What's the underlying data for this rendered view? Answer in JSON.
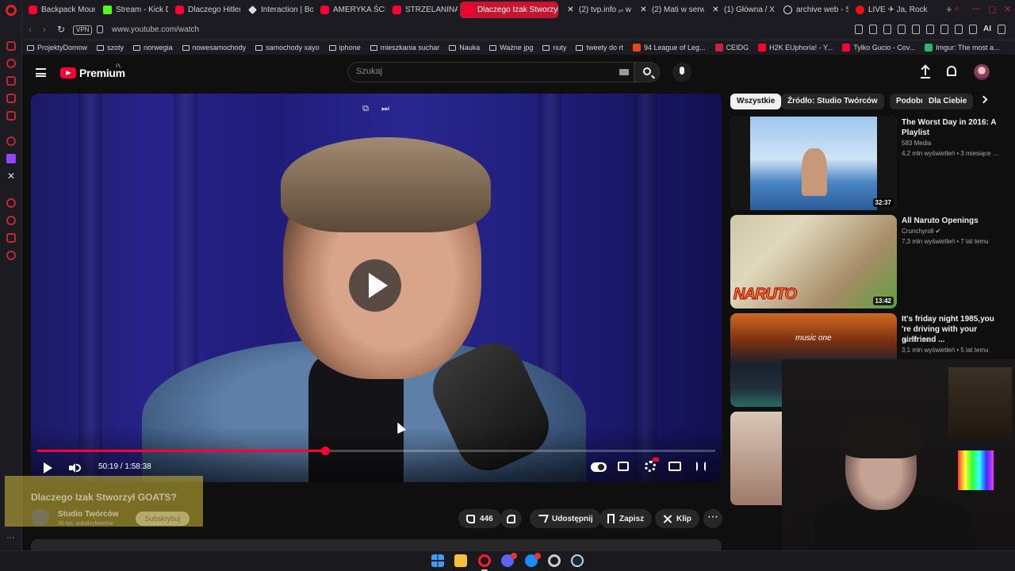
{
  "browser": {
    "tabs": [
      {
        "label": "Backpack Moun",
        "icon": "youtube-icon"
      },
      {
        "label": "Stream - Kick D",
        "icon": "kick-icon"
      },
      {
        "label": "Dlaczego Hitler",
        "icon": "youtube-icon"
      },
      {
        "label": "Interaction | Bol",
        "icon": "diamond-icon"
      },
      {
        "label": "AMERYKA ŚCIA",
        "icon": "youtube-icon"
      },
      {
        "label": "STRZELANINA W",
        "icon": "youtube-icon"
      },
      {
        "label": "Dlaczego Izak Stworzył G",
        "icon": "youtube-icon",
        "active": true
      },
      {
        "label": "(2) tvp.info ₚₗ w",
        "icon": "x-icon"
      },
      {
        "label": "(2) Mati w serwi",
        "icon": "x-icon"
      },
      {
        "label": "(1) Główna / X",
        "icon": "x-icon"
      },
      {
        "label": "archive web - S",
        "icon": "globe-icon"
      },
      {
        "label": "LIVE ✈ Ja, Rock",
        "icon": "record-icon"
      }
    ],
    "vpn_label": "VPN",
    "url": "www.youtube.com/watch",
    "ai_label": "AI",
    "bookmarks": [
      {
        "label": "ProjektyDomow",
        "type": "folder"
      },
      {
        "label": "szoty",
        "type": "folder"
      },
      {
        "label": "norwegia",
        "type": "folder"
      },
      {
        "label": "nowesamochody",
        "type": "folder"
      },
      {
        "label": "samochody xayo",
        "type": "folder"
      },
      {
        "label": "iphone",
        "type": "folder"
      },
      {
        "label": "mieszkania suchar",
        "type": "folder"
      },
      {
        "label": "Nauka",
        "type": "folder"
      },
      {
        "label": "Ważne jpg",
        "type": "folder"
      },
      {
        "label": "nuty",
        "type": "folder"
      },
      {
        "label": "tweety do rt",
        "type": "folder"
      },
      {
        "label": "94 League of Leg...",
        "type": "site",
        "color": "#e04a1a"
      },
      {
        "label": "CEIDG",
        "type": "site",
        "color": "#d02040"
      },
      {
        "label": "H2K EUphoria! - Y...",
        "type": "site",
        "color": "#ff0033"
      },
      {
        "label": "Tylko Gucio - Cov...",
        "type": "site",
        "color": "#ff0033"
      },
      {
        "label": "Imgur: The most a...",
        "type": "site",
        "color": "#2fb36b"
      }
    ]
  },
  "youtube": {
    "logo_text": "Premium",
    "logo_region": "PL",
    "search_placeholder": "Szukaj",
    "player": {
      "current_time": "50:19",
      "duration": "1:58:38",
      "time_display": "50:19 / 1:58:38",
      "progress_fraction": 0.424
    },
    "video": {
      "title": "Dlaczego Izak Stworzył GOATS?",
      "channel": "Studio Twórców",
      "subscribers": "30 tys. subskrybentów",
      "subscribe_label": "Subskrybuj",
      "likes": "446",
      "share_label": "Udostępnij",
      "save_label": "Zapisz",
      "clip_label": "Klip"
    },
    "chips": [
      "Wszystkie",
      "Źródło: Studio Twórców",
      "Podobne",
      "Dla Ciebie"
    ],
    "recommended": [
      {
        "title": "The Worst Day in 2016: A Playlist",
        "channel": "583 Media",
        "meta": "4,2 mln wyświetleń • 3 miesiące ...",
        "duration": "32:37"
      },
      {
        "title": "All Naruto Openings",
        "channel": "Crunchyroll ✔",
        "meta": "7,3 mln wyświetleń • 7 lat temu",
        "duration": "13:42",
        "thumb_text": "NARUTO"
      },
      {
        "title": "It's friday night 1985,you 're driving with your girlfriend ...",
        "channel": "music one",
        "meta": "3,1 mln wyświetleń • 5 lat temu",
        "thumb_text": "music one"
      }
    ]
  },
  "colors": {
    "accent": "#ff0033",
    "opera_red": "#c8152f",
    "background": "#0f0f0f"
  }
}
